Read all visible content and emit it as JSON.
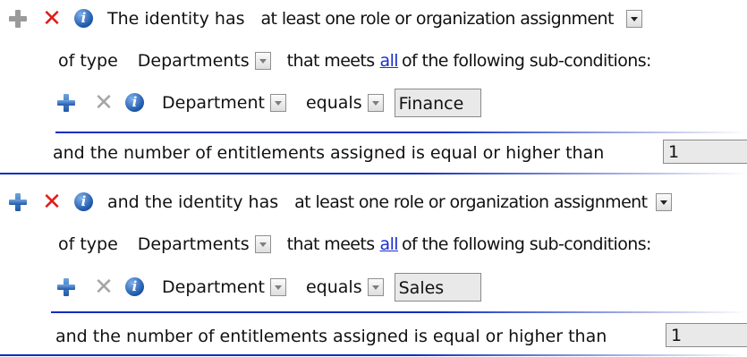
{
  "rule1": {
    "prefix": "The identity has",
    "assignment_select": "at least one role or organization assignment",
    "of_type_label": "of type",
    "type_select": "Departments",
    "meets_prefix": "that meets",
    "meets_link": "all",
    "meets_suffix": "of the following sub-conditions:",
    "sub": {
      "field": "Department",
      "operator": "equals",
      "value": "Finance"
    },
    "entitlements_label": "and the number of entitlements assigned is equal or higher than",
    "entitlements_value": "1"
  },
  "rule2": {
    "prefix": "and the identity has",
    "assignment_select": "at least one role or organization assignment",
    "of_type_label": "of type",
    "type_select": "Departments",
    "meets_prefix": "that meets",
    "meets_link": "all",
    "meets_suffix": "of the following sub-conditions:",
    "sub": {
      "field": "Department",
      "operator": "equals",
      "value": "Sales"
    },
    "entitlements_label": "and the number of entitlements assigned is equal or higher than",
    "entitlements_value": "1"
  },
  "colors": {
    "link": "#1a2fcf",
    "remove": "#e11b1b",
    "separator": "#0d2dc0",
    "add": "#1f58a8"
  },
  "icons": [
    "plus-icon",
    "close-icon",
    "info-icon",
    "chevron-down-icon"
  ]
}
